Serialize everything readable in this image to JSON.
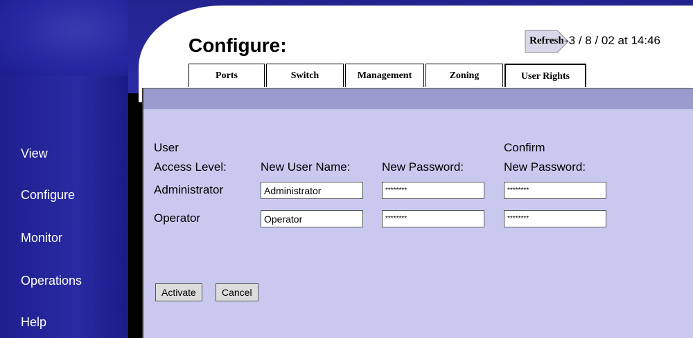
{
  "header": {
    "title": "Configure:",
    "refresh_label": "Refresh",
    "timestamp": "-3 / 8 / 02 at 14:46"
  },
  "nav": {
    "items": [
      {
        "label": "View"
      },
      {
        "label": "Configure"
      },
      {
        "label": "Monitor"
      },
      {
        "label": "Operations"
      },
      {
        "label": "Help"
      }
    ]
  },
  "tabs": [
    {
      "label": "Ports"
    },
    {
      "label": "Switch"
    },
    {
      "label": "Management"
    },
    {
      "label": "Zoning"
    },
    {
      "label": "User Rights",
      "active": true
    }
  ],
  "form": {
    "col_access_1": "User",
    "col_access_2": "Access Level:",
    "col_username": "New User Name:",
    "col_password": "New Password:",
    "col_confirm_1": "Confirm",
    "col_confirm_2": "New Password:",
    "rows": [
      {
        "level": "Administrator",
        "username": "Administrator",
        "password": "********",
        "confirm": "********"
      },
      {
        "level": "Operator",
        "username": "Operator",
        "password": "********",
        "confirm": "********"
      }
    ]
  },
  "buttons": {
    "activate": "Activate",
    "cancel": "Cancel"
  },
  "colors": {
    "nav_bg": "#2626a0",
    "panel_bg": "#c9c9f0",
    "panel_header": "#9a9acc"
  }
}
